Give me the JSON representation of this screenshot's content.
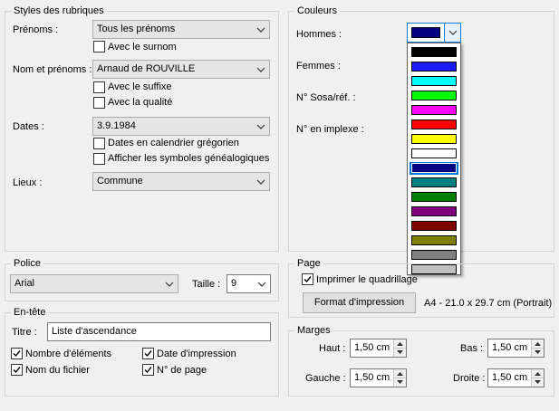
{
  "styles": {
    "legend": "Styles des rubriques",
    "prenoms_label": "Prénoms :",
    "prenoms_value": "Tous les prénoms",
    "avec_surnom": "Avec le surnom",
    "nom_label": "Nom et prénoms :",
    "nom_value": "Arnaud de ROUVILLE",
    "avec_suffixe": "Avec le suffixe",
    "avec_qualite": "Avec la qualité",
    "dates_label": "Dates :",
    "dates_value": "3.9.1984",
    "dates_gregorien": "Dates en calendrier grégorien",
    "symboles": "Afficher les symboles généalogiques",
    "lieux_label": "Lieux :",
    "lieux_value": "Commune"
  },
  "couleurs": {
    "legend": "Couleurs",
    "hommes": "Hommes :",
    "femmes": "Femmes :",
    "sosa": "N° Sosa/réf. :",
    "implexe": "N° en implexe :",
    "hommes_color": "#000080",
    "palette": [
      {
        "name": "black",
        "hex": "#000000"
      },
      {
        "name": "blue",
        "hex": "#1a1aff"
      },
      {
        "name": "cyan",
        "hex": "#00ffff"
      },
      {
        "name": "green",
        "hex": "#00ff00"
      },
      {
        "name": "magenta",
        "hex": "#ff00ff"
      },
      {
        "name": "red",
        "hex": "#ff0000"
      },
      {
        "name": "yellow",
        "hex": "#ffff00"
      },
      {
        "name": "white",
        "hex": "#ffffff"
      },
      {
        "name": "navy",
        "hex": "#000080",
        "selected": true
      },
      {
        "name": "teal",
        "hex": "#008080"
      },
      {
        "name": "dark-green",
        "hex": "#008000"
      },
      {
        "name": "purple",
        "hex": "#800080"
      },
      {
        "name": "maroon",
        "hex": "#800000"
      },
      {
        "name": "olive",
        "hex": "#808000"
      },
      {
        "name": "gray",
        "hex": "#808080"
      },
      {
        "name": "silver",
        "hex": "#c0c0c0"
      }
    ]
  },
  "police": {
    "legend": "Police",
    "font_value": "Arial",
    "taille_label": "Taille :",
    "taille_value": "9"
  },
  "page": {
    "legend": "Page",
    "quadrillage": "Imprimer le quadrillage",
    "format_button": "Format d'impression",
    "format_info": "A4 - 21.0 x 29.7 cm (Portrait)"
  },
  "entete": {
    "legend": "En-tête",
    "titre_label": "Titre :",
    "titre_value": "Liste d'ascendance",
    "nombre": "Nombre d'éléments",
    "date_impression": "Date d'impression",
    "nom_fichier": "Nom du fichier",
    "num_page": "N° de page"
  },
  "marges": {
    "legend": "Marges",
    "haut_label": "Haut :",
    "haut_value": "1,50 cm",
    "bas_label": "Bas :",
    "bas_value": "1,50 cm",
    "gauche_label": "Gauche :",
    "gauche_value": "1,50 cm",
    "droite_label": "Droite :",
    "droite_value": "1,50 cm"
  }
}
